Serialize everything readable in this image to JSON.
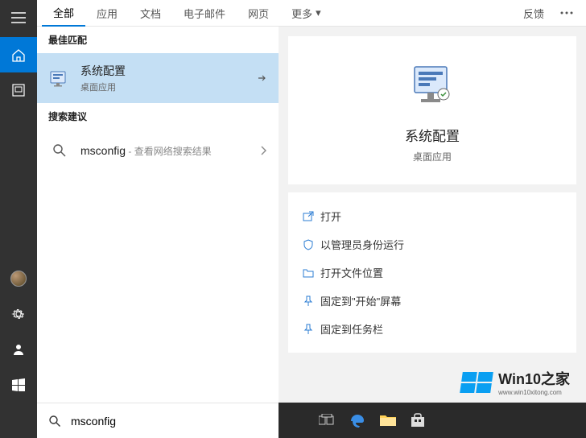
{
  "tabs": {
    "all": "全部",
    "apps": "应用",
    "docs": "文档",
    "email": "电子邮件",
    "web": "网页",
    "more": "更多",
    "feedback": "反馈"
  },
  "sections": {
    "best_match": "最佳匹配",
    "suggestions": "搜索建议"
  },
  "best_result": {
    "title": "系统配置",
    "subtitle": "桌面应用"
  },
  "suggestion": {
    "query": "msconfig",
    "hint": " - 查看网络搜索结果"
  },
  "detail": {
    "title": "系统配置",
    "subtitle": "桌面应用"
  },
  "actions": {
    "open": "打开",
    "admin": "以管理员身份运行",
    "open_location": "打开文件位置",
    "pin_start": "固定到\"开始\"屏幕",
    "pin_taskbar": "固定到任务栏"
  },
  "search": {
    "value": "msconfig",
    "placeholder": ""
  },
  "watermark": {
    "title": "Win10之家",
    "url": "www.win10xitong.com"
  }
}
